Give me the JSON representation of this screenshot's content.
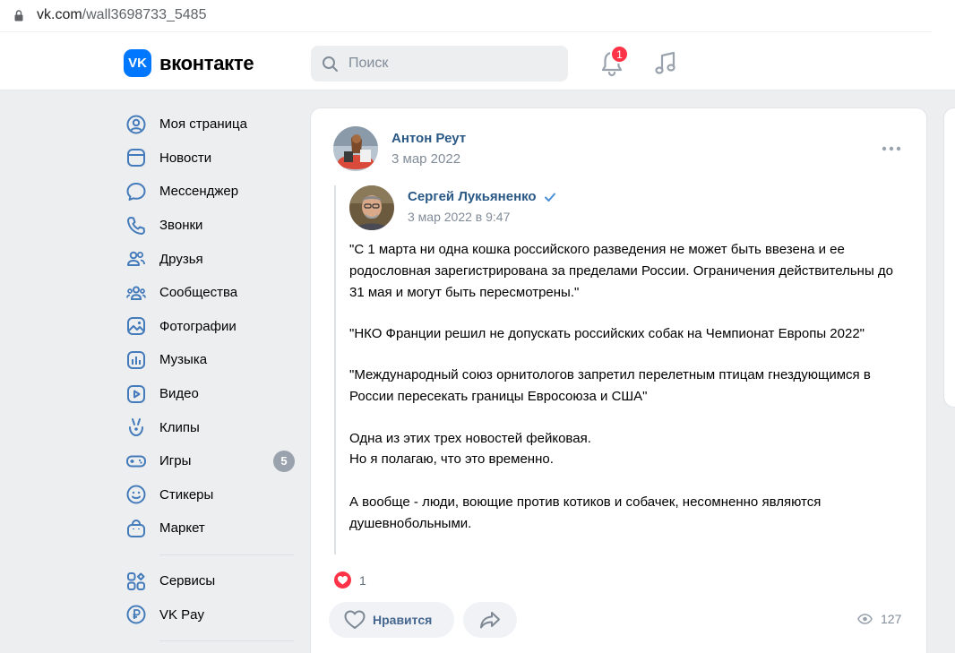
{
  "browser": {
    "url_domain": "vk.com",
    "url_path": "/wall3698733_5485"
  },
  "header": {
    "logo_mark": "VK",
    "logo_text": "вконтакте",
    "search_placeholder": "Поиск",
    "notifications_count": "1"
  },
  "sidebar": {
    "items": [
      {
        "label": "Моя страница",
        "icon": "user-circle-icon"
      },
      {
        "label": "Новости",
        "icon": "news-icon"
      },
      {
        "label": "Мессенджер",
        "icon": "message-icon"
      },
      {
        "label": "Звонки",
        "icon": "phone-icon"
      },
      {
        "label": "Друзья",
        "icon": "friends-icon"
      },
      {
        "label": "Сообщества",
        "icon": "communities-icon"
      },
      {
        "label": "Фотографии",
        "icon": "photo-icon"
      },
      {
        "label": "Музыка",
        "icon": "music-icon"
      },
      {
        "label": "Видео",
        "icon": "video-icon"
      },
      {
        "label": "Клипы",
        "icon": "clips-icon"
      },
      {
        "label": "Игры",
        "icon": "games-icon",
        "badge": "5"
      },
      {
        "label": "Стикеры",
        "icon": "smile-icon"
      },
      {
        "label": "Маркет",
        "icon": "market-icon"
      }
    ],
    "secondary": [
      {
        "label": "Сервисы",
        "icon": "services-icon"
      },
      {
        "label": "VK Pay",
        "icon": "vkpay-icon"
      }
    ]
  },
  "post": {
    "author": "Антон Реут",
    "date": "3 мар 2022",
    "repost": {
      "author": "Сергей Лукьяненко",
      "date": "3 мар 2022 в 9:47",
      "paragraphs": [
        "\"С 1 марта ни одна кошка российского разведения не может быть ввезена и ее родословная зарегистрирована за пределами России. Ограничения действительны до 31 мая и могут быть пересмотрены.\"",
        "\"НКО Франции решил не допускать российских собак на Чемпионат Европы 2022\"",
        "\"Международный союз орнитологов запретил перелетным птицам гнездующимся в России пересекать границы Евросоюза и США\"",
        "Одна из этих трех новостей фейковая.",
        "Но я полагаю, что это временно.",
        "А вообще - люди, воющие против котиков и собачек, несомненно являются душевнобольными."
      ]
    },
    "reactions_count": "1",
    "like_label": "Нравится",
    "views_count": "127"
  },
  "colors": {
    "brand": "#0077ff",
    "link": "#2a5885",
    "badge_red": "#ff3347",
    "icon_blue": "#447bba"
  }
}
